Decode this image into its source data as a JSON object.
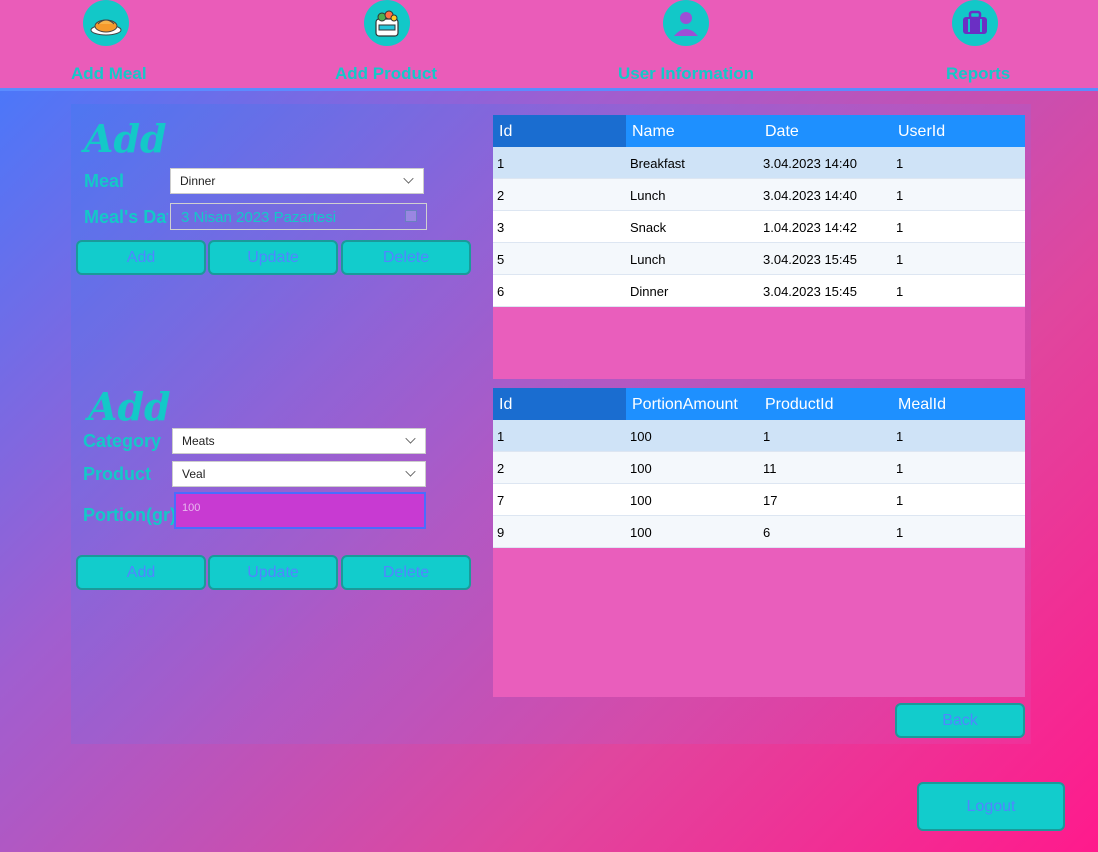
{
  "nav": {
    "items": [
      {
        "label": "Add Meal",
        "icon": "meal-plate-icon"
      },
      {
        "label": "Add Product",
        "icon": "grocery-bag-icon"
      },
      {
        "label": "User Information",
        "icon": "user-icon"
      },
      {
        "label": "Reports",
        "icon": "briefcase-icon"
      }
    ]
  },
  "meal_section": {
    "title": "Add",
    "meal_label": "Meal",
    "meal_value": "Dinner",
    "date_label": "Meal's Date",
    "date_value": "3 Nisan 2023 Pazartesi",
    "buttons": {
      "add": "Add",
      "update": "Update",
      "delete": "Delete"
    }
  },
  "product_section": {
    "title": "Add",
    "category_label": "Category",
    "category_value": "Meats",
    "product_label": "Product",
    "product_value": "Veal",
    "portion_label": "Portion(gr)",
    "portion_value": "100",
    "buttons": {
      "add": "Add",
      "update": "Update",
      "delete": "Delete"
    }
  },
  "meals_grid": {
    "columns": [
      "Id",
      "Name",
      "Date",
      "UserId"
    ],
    "rows": [
      [
        "1",
        "Breakfast",
        "3.04.2023 14:40",
        "1"
      ],
      [
        "2",
        "Lunch",
        "3.04.2023 14:40",
        "1"
      ],
      [
        "3",
        "Snack",
        "1.04.2023 14:42",
        "1"
      ],
      [
        "5",
        "Lunch",
        "3.04.2023 15:45",
        "1"
      ],
      [
        "6",
        "Dinner",
        "3.04.2023 15:45",
        "1"
      ]
    ]
  },
  "portions_grid": {
    "columns": [
      "Id",
      "PortionAmount",
      "ProductId",
      "MealId"
    ],
    "rows": [
      [
        "1",
        "100",
        "1",
        "1"
      ],
      [
        "2",
        "100",
        "11",
        "1"
      ],
      [
        "7",
        "100",
        "17",
        "1"
      ],
      [
        "9",
        "100",
        "6",
        "1"
      ]
    ]
  },
  "back_label": "Back",
  "logout_label": "Logout",
  "colors": {
    "accent_teal": "#12cccc",
    "topbar_pink": "#ea5cb9",
    "grid_header_blue": "#1e90ff",
    "button_text_blue": "#4f86ff"
  }
}
